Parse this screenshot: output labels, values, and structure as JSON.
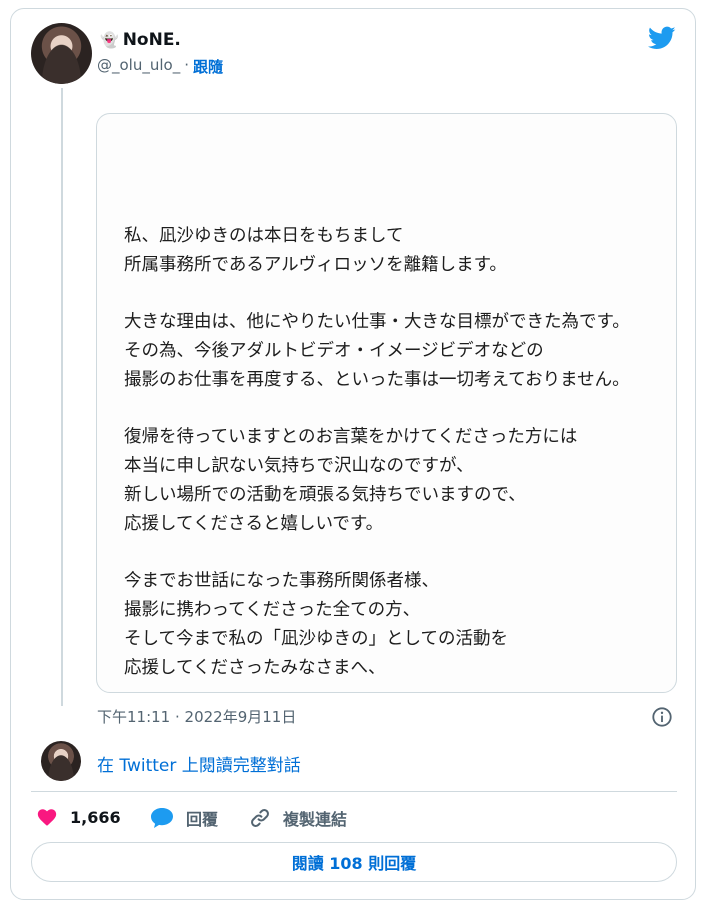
{
  "tweet": {
    "display_name": "NoNE.",
    "name_emoji": "👻",
    "handle": "@_olu_ulo_",
    "separator": "·",
    "follow_label": "跟隨",
    "image_text": [
      [
        "私、凪沙ゆきのは本日をもちまして",
        "所属事務所であるアルヴィロッソを離籍します。"
      ],
      [
        "大きな理由は、他にやりたい仕事・大きな目標ができた為です。",
        "その為、今後アダルトビデオ・イメージビデオなどの",
        "撮影のお仕事を再度する、といった事は一切考えておりません。"
      ],
      [
        "復帰を待っていますとのお言葉をかけてくださった方には",
        "本当に申し訳ない気持ちで沢山なのですが、",
        "新しい場所での活動を頑張る気持ちでいますので、",
        "応援してくださると嬉しいです。"
      ],
      [
        "今までお世話になった事務所関係者様、",
        "撮影に携わってくださった全ての方、",
        "そして今まで私の「凪沙ゆきの」としての活動を",
        "応援してくださったみなさまへ、"
      ]
    ],
    "timestamp": "下午11:11 · 2022年9月11日",
    "read_conversation": "在 Twitter 上閱讀完整對話"
  },
  "actions": {
    "likes_count": "1,666",
    "reply_label": "回覆",
    "copy_link_label": "複製連結"
  },
  "read_replies_button": "閱讀 108 則回覆",
  "colors": {
    "accent": "#006fd6",
    "twitter_blue": "#1d9bf0",
    "like": "#f91880",
    "border": "#cfd9de",
    "muted": "#536471"
  }
}
